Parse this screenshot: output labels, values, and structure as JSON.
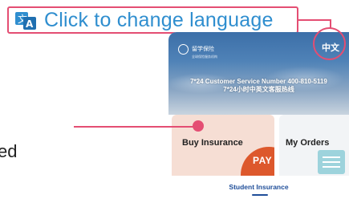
{
  "callout": {
    "text": "Click to change language"
  },
  "phone": {
    "brand_name": "留学保险",
    "brand_sub": "全球保险服务机构",
    "lang_toggle": "中文",
    "hotline_en": "7*24 Customer Service Number 400-810-5119",
    "hotline_cn": "7*24小时中英文客服热线",
    "buy_label": "Buy Insurance",
    "pay_label": "PAY",
    "orders_label": "My Orders",
    "tab_label": "Student Insurance"
  },
  "left_text": "ed",
  "colors": {
    "accent": "#e44e73",
    "link": "#2f8ecf",
    "pay": "#dd582c",
    "tab": "#1f4e99"
  }
}
